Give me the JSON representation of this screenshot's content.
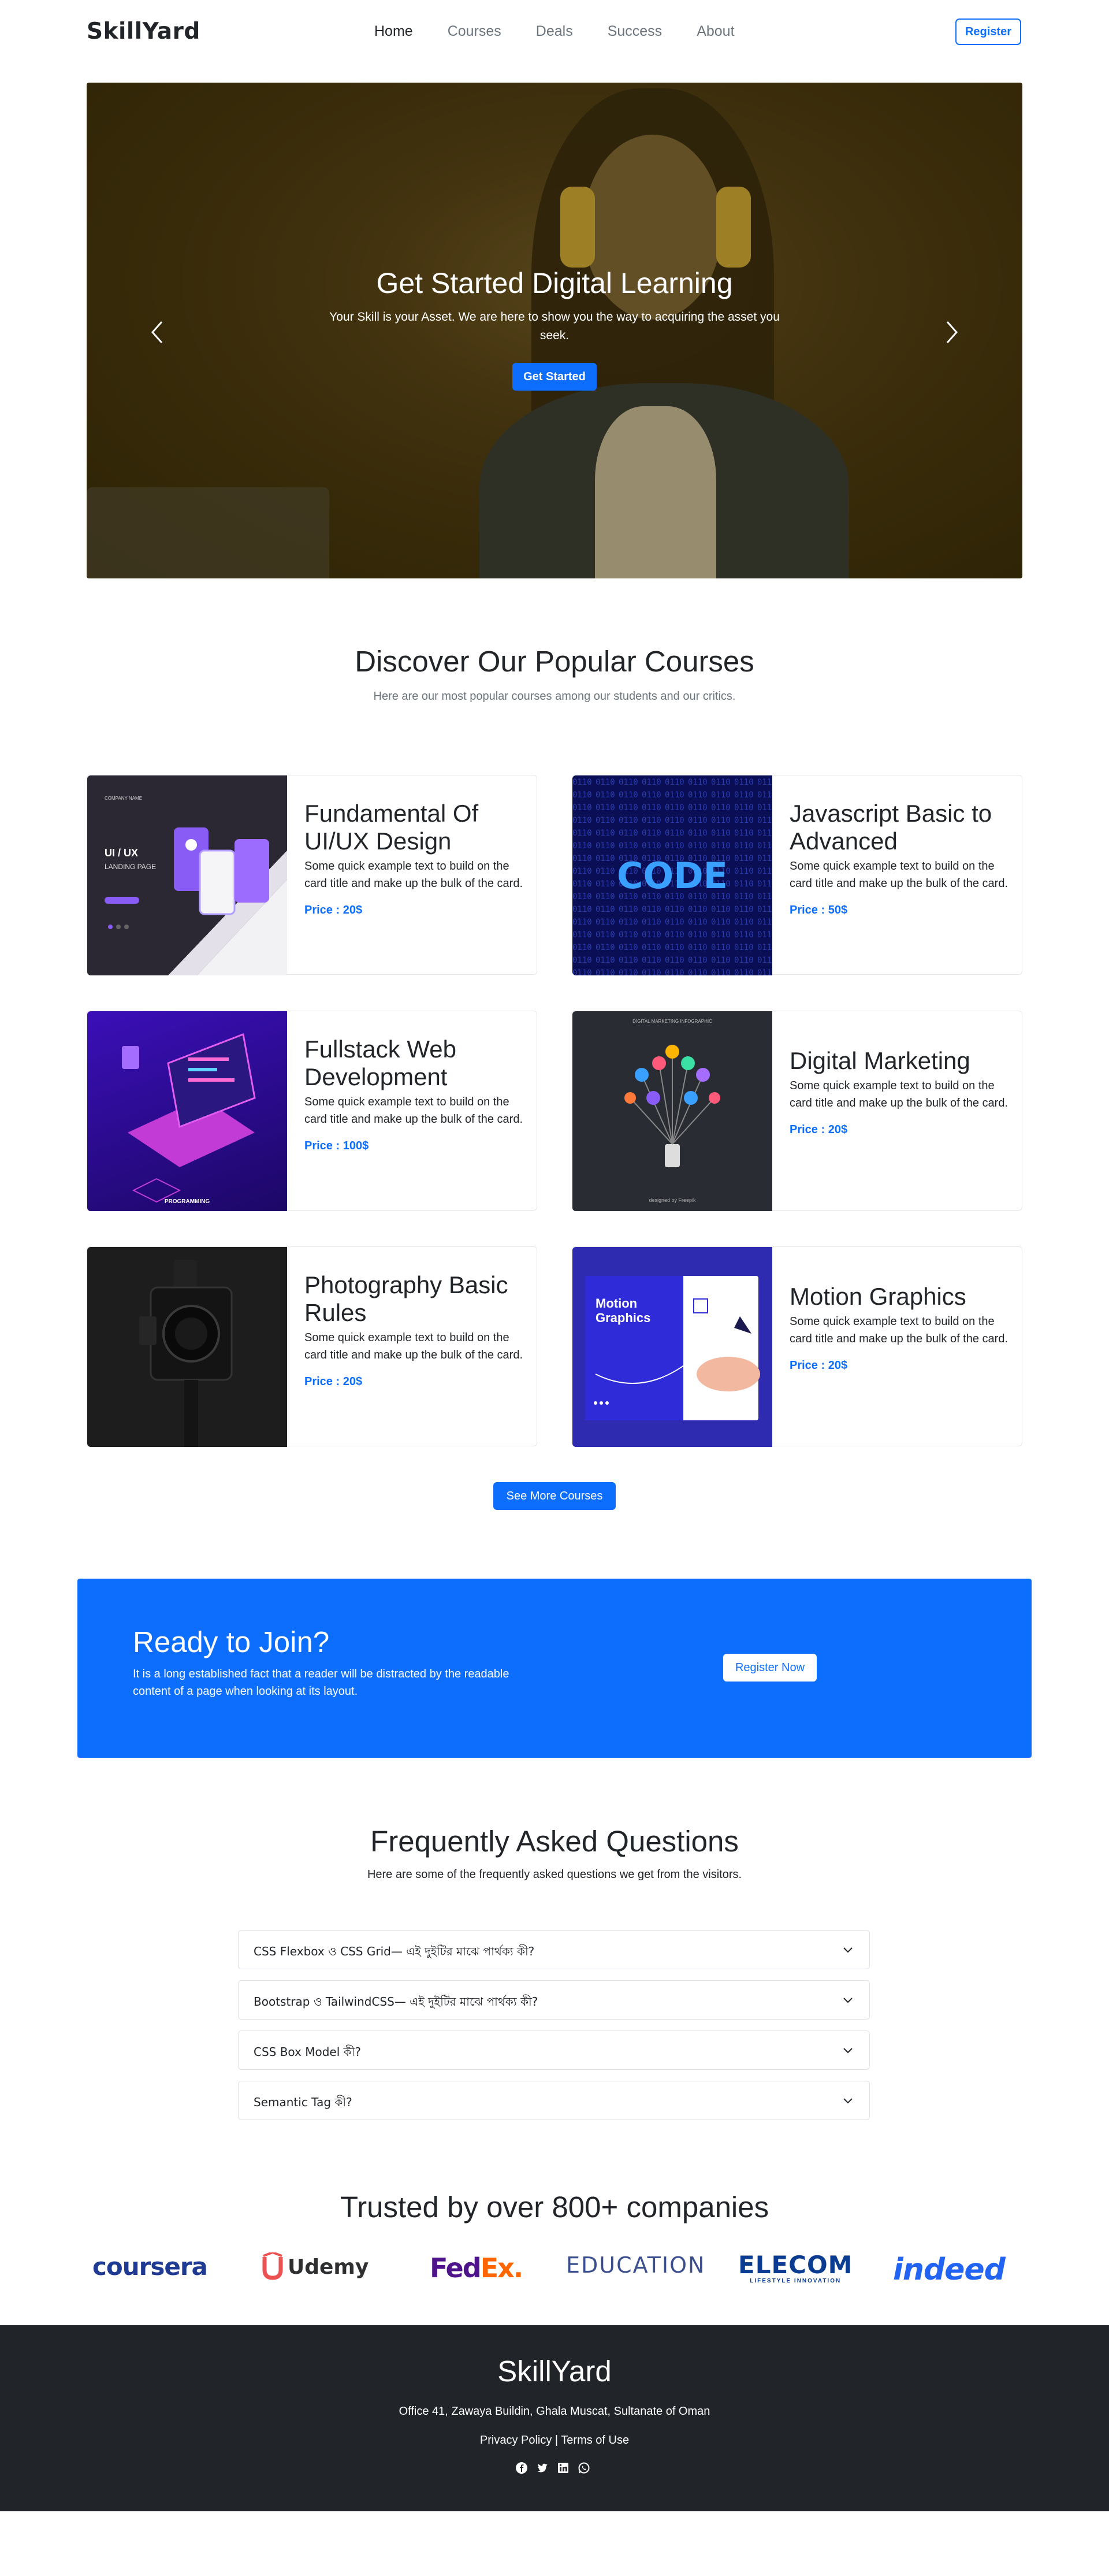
{
  "nav": {
    "brand": "SkillYard",
    "links": [
      "Home",
      "Courses",
      "Deals",
      "Success",
      "About"
    ],
    "register": "Register"
  },
  "hero": {
    "title": "Get Started Digital Learning",
    "subtitle": "Your Skill is your Asset. We are here to show you the way to acquiring the asset you seek.",
    "button": "Get Started"
  },
  "courses_section": {
    "title": "Discover Our Popular Courses",
    "subtitle": "Here are our most popular courses among our students and our critics.",
    "more_button": "See More Courses",
    "items": [
      {
        "title": "Fundamental Of UI/UX Design",
        "text": "Some quick example text to build on the card title and make up the bulk of the card.",
        "price": "Price : 20$",
        "thumb_title": "UI / UX",
        "thumb_sub": "LANDING PAGE",
        "thumb_brand": "COMPANY NAME"
      },
      {
        "title": "Javascript Basic to Advanced",
        "text": "Some quick example text to build on the card title and make up the bulk of the card.",
        "price": "Price : 50$",
        "thumb_title": "CODE"
      },
      {
        "title": "Fullstack Web Development",
        "text": "Some quick example text to build on the card title and make up the bulk of the card.",
        "price": "Price : 100$",
        "thumb_title": "PROGRAMMING"
      },
      {
        "title": "Digital Marketing",
        "text": "Some quick example text to build on the card title and make up the bulk of the card.",
        "price": "Price : 20$",
        "thumb_title": "DIGITAL MARKETING INFOGRAPHIC",
        "thumb_sub": "designed by Freepik"
      },
      {
        "title": "Photography Basic Rules",
        "text": "Some quick example text to build on the card title and make up the bulk of the card.",
        "price": "Price : 20$"
      },
      {
        "title": "Motion Graphics",
        "text": "Some quick example text to build on the card title and make up the bulk of the card.",
        "price": "Price : 20$",
        "thumb_title": "Motion Graphics"
      }
    ]
  },
  "join": {
    "title": "Ready to Join?",
    "text": "It is a long established fact that a reader will be distracted by the readable content of a page when looking at its layout.",
    "button": "Register Now"
  },
  "faq": {
    "title": "Frequently Asked Questions",
    "subtitle": "Here are some of the frequently asked questions we get from the visitors.",
    "items": [
      "CSS Flexbox ও CSS Grid— এই দুইটির মাঝে পার্থক্য কী?",
      "Bootstrap ও TailwindCSS— এই দুইটির মাঝে পার্থক্য কী?",
      "CSS Box Model কী?",
      "Semantic Tag কী?"
    ]
  },
  "companies": {
    "title": "Trusted by over 800+ companies",
    "logos": [
      "coursera",
      "Udemy",
      "FedEx",
      "EDUCATION",
      "ELECOM",
      "indeed"
    ],
    "elecom_sub": "LIFESTYLE INNOVATION",
    "colors": {
      "coursera": "#1f3a93",
      "udemy": "#a435f0",
      "udemy_u": "#ec5252",
      "fedex_fed": "#4d148c",
      "fedex_ex": "#ff6600",
      "education": "#3b4f8f",
      "elecom": "#0a3d91",
      "indeed": "#2164f3"
    }
  },
  "footer": {
    "brand": "SkillYard",
    "address": "Office 41, Zawaya Buildin, Ghala Muscat, Sultanate of Oman",
    "links": "Privacy Policy | Terms of Use",
    "social": [
      "facebook-icon",
      "twitter-icon",
      "linkedin-icon",
      "whatsapp-icon"
    ]
  },
  "colors": {
    "primary": "#0d6efd",
    "dark": "#212529",
    "muted": "#6c757d"
  }
}
